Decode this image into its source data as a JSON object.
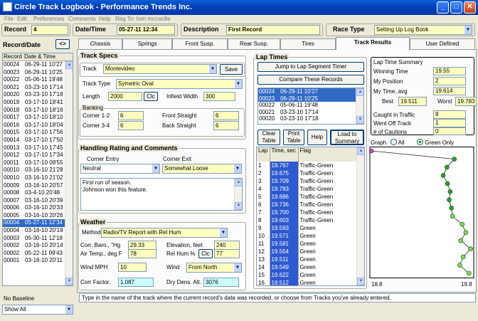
{
  "window": {
    "title": "Circle Track Logbook - Performance Trends Inc."
  },
  "menu": [
    "File",
    "Edit",
    "Preferences",
    "Comments",
    "Help",
    "Reg To: tom mccardle"
  ],
  "header": {
    "record_label": "Record",
    "record_value": "4",
    "datetime_label": "Date/Time",
    "datetime_value": "05-27-11 12:34",
    "description_label": "Description",
    "description_value": "First Record",
    "racetype_label": "Race Type",
    "racetype_value": "Setting Up Log Book"
  },
  "tabs": [
    "Chassis",
    "Springs",
    "Front Susp.",
    "Rear Susp.",
    "Tires",
    "Track Results",
    "User Defined"
  ],
  "active_tab": "Track Results",
  "left_panel": {
    "title": "Record/Date",
    "nav_arrows": "<>",
    "col_record": "Record",
    "col_date": "Date & Time",
    "rows": [
      [
        "00024",
        "06-29-11 10'27"
      ],
      [
        "00023",
        "06-29-11 10'25"
      ],
      [
        "00022",
        "05-06-11 19'48"
      ],
      [
        "00021",
        "03-23-10 17'14"
      ],
      [
        "00020",
        "03-23-10 17'18"
      ],
      [
        "00019",
        "03-17-10 18'41"
      ],
      [
        "00018",
        "03-17-10 18'16"
      ],
      [
        "00017",
        "03-17-10 18'10"
      ],
      [
        "00016",
        "03-17-10 18'04"
      ],
      [
        "00015",
        "03-17-10 17'56"
      ],
      [
        "00014",
        "03-17-10 17'50"
      ],
      [
        "00013",
        "03-17-10 17'45"
      ],
      [
        "00012",
        "03-17-10 17'34"
      ],
      [
        "00011",
        "03-17-10 08'55"
      ],
      [
        "00010",
        "03-16-10 21'28"
      ],
      [
        "00010",
        "03-16-10 21'02"
      ],
      [
        "00009",
        "03-16-10 20'57"
      ],
      [
        "00008",
        "03-4-10 20'48"
      ],
      [
        "00007",
        "03-16-10 20'39"
      ],
      [
        "00006",
        "03-16-10 20'33"
      ],
      [
        "00005",
        "03-16-10 20'26"
      ],
      [
        "00004",
        "05-27-11 12'34"
      ],
      [
        "00004",
        "03-16-10 20'19"
      ],
      [
        "00003",
        "05-30-11 12'18"
      ],
      [
        "00002",
        "03-16-10 20'14"
      ],
      [
        "00002",
        "05-22-11 09'43"
      ],
      [
        "00001",
        "03-16-10 20'11"
      ]
    ],
    "selected_index": 21,
    "baseline_label": "No Baseline",
    "show_value": "Show All"
  },
  "track_specs": {
    "title": "Track Specs",
    "track_label": "Track",
    "track_value": "Montevideo",
    "save_label": "Save",
    "type_label": "Track Type",
    "type_value": "Symetric Oval",
    "length_label": "Length",
    "length_value": "2000",
    "clc_label": "Clc",
    "infield_label": "Infield Width",
    "infield_value": "300",
    "banking_label": "Banking",
    "corner12_label": "Corner 1-2",
    "corner12_value": "6",
    "corner34_label": "Corner 3-4",
    "corner34_value": "6",
    "front_label": "Front Straight",
    "front_value": "6",
    "back_label": "Back Straight",
    "back_value": "6"
  },
  "handling": {
    "title": "Handling Rating and Comments",
    "entry_label": "Corner Entry",
    "entry_value": "Neutral",
    "exit_label": "Corner Exit",
    "exit_value": "Somewhat Loose",
    "comments": [
      "First run of season.",
      "Johnson won this feature."
    ]
  },
  "weather": {
    "title": "Weather",
    "method_label": "Method",
    "method_value": "Radio/TV Report with Rel Hum",
    "baro_label": "Corr. Baro., \"Hg",
    "baro_value": "29.33",
    "elev_label": "Elevation, feet",
    "elev_value": "240",
    "air_label": "Air Temp., deg F",
    "air_value": "78",
    "relhum_label": "Rel Hum %",
    "clc_label": "Clc",
    "relhum_value": "77",
    "wind_mph_label": "Wind MPH",
    "wind_mph_value": "10",
    "wind_label": "Wind",
    "wind_value": "From North",
    "corr_label": "Corr Factor.",
    "corr_value": "1.087",
    "dry_label": "Dry Dens. Alt.",
    "dry_value": "3076"
  },
  "lap_times": {
    "title": "Lap Times",
    "jump_label": "Jump to Lap Segment Timer",
    "compare_label": "Compare These Records",
    "compare_list": [
      [
        "00024",
        "06-29-11 10'27"
      ],
      [
        "00023",
        "06-29-11 10'25"
      ],
      [
        "00022",
        "05-06-11 19'48"
      ],
      [
        "00021",
        "03-23-10 17'14"
      ],
      [
        "00020",
        "03-23-10 17'18"
      ]
    ],
    "clear_label": "Clear Table",
    "print_label": "Print Table",
    "help_label": "Help",
    "load_label": "Load to Summary",
    "col_lap": "Lap",
    "col_time": "Time, sec",
    "col_flag": "Flag",
    "rows": [
      [
        "1",
        "19.767",
        "Traffic-Green"
      ],
      [
        "2",
        "19.675",
        "Traffic-Green"
      ],
      [
        "3",
        "19.709",
        "Traffic-Green"
      ],
      [
        "4",
        "19.783",
        "Traffic-Green"
      ],
      [
        "5",
        "19.686",
        "Traffic-Green"
      ],
      [
        "6",
        "19.736",
        "Traffic-Green"
      ],
      [
        "7",
        "19.700",
        "Traffic-Green"
      ],
      [
        "8",
        "19.603",
        "Traffic-Green"
      ],
      [
        "9",
        "19.593",
        "Green"
      ],
      [
        "10",
        "19.571",
        "Green"
      ],
      [
        "11",
        "19.581",
        "Green"
      ],
      [
        "12",
        "19.554",
        "Green"
      ],
      [
        "13",
        "19.511",
        "Green"
      ],
      [
        "14",
        "19.549",
        "Green"
      ],
      [
        "15",
        "19.622",
        "Green"
      ],
      [
        "16",
        "18.512",
        "Green"
      ]
    ]
  },
  "summary": {
    "title": "Lap Time Summary",
    "winning_label": "Winning Time",
    "winning_value": "19.55",
    "position_label": "My Position",
    "position_value": "2",
    "avg_label": "My Time, avg",
    "avg_value": "19.614",
    "best_label": "Best",
    "best_value": "19.511",
    "worst_label": "Worst",
    "worst_value": "19.783",
    "caught_label": "Caught in Traffic",
    "caught_value": "8",
    "offtrack_label": "Went Off Track",
    "offtrack_value": "1",
    "cautions_label": "# of Cautions",
    "cautions_value": "0"
  },
  "graph": {
    "label": "Graph",
    "all_label": "All",
    "green_label": "Green Only",
    "xmin_label": "18.8",
    "xmax_label": "19.8"
  },
  "chart_data": {
    "type": "scatter",
    "xlim": [
      18.8,
      19.8
    ],
    "series": [
      {
        "values": [
          19.767,
          19.675,
          19.709,
          19.783,
          19.686,
          19.736,
          19.7,
          19.603,
          19.593,
          19.571,
          19.581,
          19.554,
          19.511,
          19.549,
          19.622,
          18.512
        ]
      }
    ]
  },
  "colors": {
    "title_blue": "#0a5fd8",
    "select_blue": "#316ac5",
    "field_yellow": "#ffffc0",
    "field_cyan": "#ccffff",
    "green_dot": "#2e9e2e",
    "magenta_dot": "#d040d0"
  },
  "status_text": "Type in the name of the track where the current record's data was recorded, or choose from Tracks you've already entered."
}
